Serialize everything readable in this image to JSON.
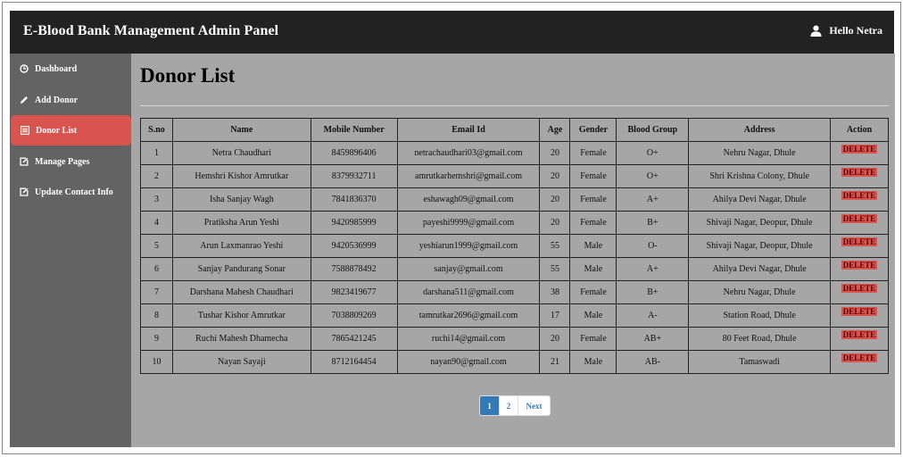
{
  "app": {
    "title": "E-Blood Bank Management Admin Panel",
    "greeting": "Hello Netra"
  },
  "sidebar": {
    "items": [
      {
        "label": "Dashboard",
        "icon": "dashboard-icon",
        "active": false
      },
      {
        "label": "Add Donor",
        "icon": "pencil-icon",
        "active": false
      },
      {
        "label": "Donor List",
        "icon": "list-icon",
        "active": true
      },
      {
        "label": "Manage Pages",
        "icon": "edit-icon",
        "active": false
      },
      {
        "label": "Update Contact Info",
        "icon": "edit-icon",
        "active": false
      }
    ]
  },
  "main": {
    "title": "Donor List",
    "table": {
      "headers": [
        "S.no",
        "Name",
        "Mobile Number",
        "Email Id",
        "Age",
        "Gender",
        "Blood Group",
        "Address",
        "Action"
      ],
      "action_label": "DELETE",
      "rows": [
        [
          "1",
          "Netra Chaudhari",
          "8459896406",
          "netrachaudhari03@gmail.com",
          "20",
          "Female",
          "O+",
          "Nehru Nagar, Dhule"
        ],
        [
          "2",
          "Hemshri Kishor Amrutkar",
          "8379932711",
          "amrutkarhemshri@gmail.com",
          "20",
          "Female",
          "O+",
          "Shri Krishna Colony, Dhule"
        ],
        [
          "3",
          "Isha Sanjay Wagh",
          "7841836370",
          "eshawagh09@gmail.com",
          "20",
          "Female",
          "A+",
          "Ahilya Devi Nagar, Dhule"
        ],
        [
          "4",
          "Pratiksha Arun Yeshi",
          "9420985999",
          "payeshi9999@gmail.com",
          "20",
          "Female",
          "B+",
          "Shivaji Nagar, Deopur, Dhule"
        ],
        [
          "5",
          "Arun Laxmanrao Yeshi",
          "9420536999",
          "yeshiarun1999@gmail.com",
          "55",
          "Male",
          "O-",
          "Shivaji Nagar, Deopur, Dhule"
        ],
        [
          "6",
          "Sanjay Pandurang Sonar",
          "7588878492",
          "sanjay@gmail.com",
          "55",
          "Male",
          "A+",
          "Ahilya Devi Nagar, Dhule"
        ],
        [
          "7",
          "Darshana Mahesh Chaudhari",
          "9823419677",
          "darshana511@gmail.com",
          "38",
          "Female",
          "B+",
          "Nehru Nagar, Dhule"
        ],
        [
          "8",
          "Tushar Kishor Amrutkar",
          "7038809269",
          "tamrutkar2696@gmail.com",
          "17",
          "Male",
          "A-",
          "Station Road, Dhule"
        ],
        [
          "9",
          "Ruchi Mahesh Dhamecha",
          "7865421245",
          "ruchi14@gmail.com",
          "20",
          "Female",
          "AB+",
          "80 Feet Road, Dhule"
        ],
        [
          "10",
          "Nayan Sayaji",
          "8712164454",
          "nayan90@gmail.com",
          "21",
          "Male",
          "AB-",
          "Tamaswadi"
        ]
      ]
    },
    "pagination": {
      "pages": [
        "1",
        "2"
      ],
      "current": "1",
      "next_label": "Next"
    }
  },
  "colors": {
    "topbar": "#222222",
    "sidebar": "#636363",
    "main_bg": "#a6a6a6",
    "active_nav": "#d9534f",
    "delete_button": "#d9534f",
    "pagination_active": "#337ab7"
  }
}
